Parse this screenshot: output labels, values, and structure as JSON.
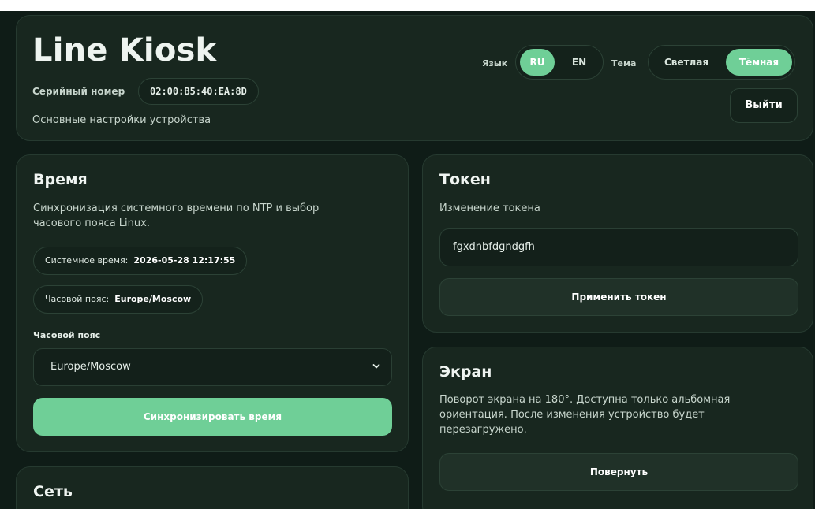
{
  "header": {
    "title": "Line Kiosk",
    "serial_label": "Серийный номер",
    "serial_value": "02:00:B5:40:EA:8D",
    "subtitle": "Основные настройки устройства",
    "language_label": "Язык",
    "languages": [
      "RU",
      "EN"
    ],
    "selected_language": "RU",
    "theme_label": "Тема",
    "themes": [
      "Светлая",
      "Тёмная"
    ],
    "selected_theme": "Тёмная",
    "logout_label": "Выйти"
  },
  "time": {
    "title": "Время",
    "description": "Синхронизация системного времени по NTP и выбор часового пояса Linux.",
    "system_time_label": "Системное время:",
    "system_time_value": "2026-05-28 12:17:55",
    "timezone_info_label": "Часовой пояс:",
    "timezone_info_value": "Europe/Moscow",
    "timezone_field_label": "Часовой пояс",
    "timezone_selected": "Europe/Moscow",
    "sync_button": "Синхронизировать время"
  },
  "token": {
    "title": "Токен",
    "description": "Изменение токена",
    "input_value": "fgxdnbfdgndgfh",
    "apply_button": "Применить токен"
  },
  "screen": {
    "title": "Экран",
    "description": "Поворот экрана на 180°. Доступна только альбомная ориентация. После изменения устройство будет перезагружено.",
    "rotate_button": "Повернуть"
  },
  "network": {
    "title": "Сеть"
  },
  "colors": {
    "background": "#0f1c17",
    "card": "#18271f",
    "accent": "#6fcf97"
  }
}
